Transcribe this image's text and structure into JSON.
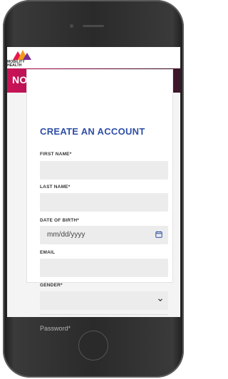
{
  "app": {
    "logo_line1": "MOBILITY",
    "logo_line2": "HEALTH",
    "banner_title": "NOLIMS"
  },
  "form": {
    "title": "CREATE AN ACCOUNT",
    "first_name_label": "FIRST NAME*",
    "last_name_label": "LAST NAME*",
    "dob_label": "DATE OF BIRTH*",
    "dob_placeholder": "mm/dd/yyyy",
    "email_label": "EMAIL",
    "gender_label": "GENDER*",
    "password_placeholder": "Password*"
  },
  "colors": {
    "title_blue": "#2f4fa6",
    "banner_start": "#cc1357",
    "banner_end": "#3a1628"
  },
  "icons": [
    "calendar-icon",
    "chevron-down-icon",
    "mobility-health-logo"
  ]
}
